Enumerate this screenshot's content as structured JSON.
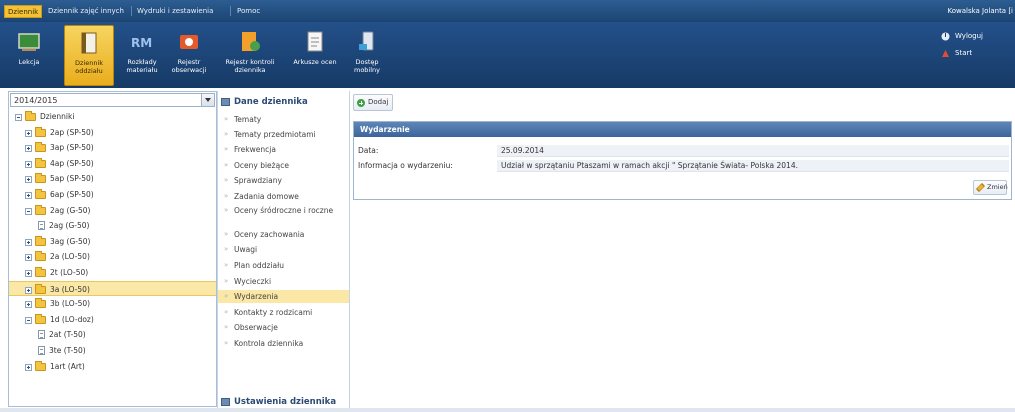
{
  "top_menu": {
    "items": [
      "Dziennik",
      "Dziennik zajęć innych",
      "Wydruki i zestawienia",
      "Pomoc"
    ],
    "active_index": 0,
    "user": "Kowalska Jolanta [i"
  },
  "toolbar": {
    "buttons": [
      {
        "label": "Lekcja",
        "icon": "board-icon"
      },
      {
        "label": "Dziennik oddziału",
        "icon": "journal-icon"
      },
      {
        "label": "Rozkłady materiału",
        "icon": "schedule-icon"
      },
      {
        "label": "Rejestr obserwacji",
        "icon": "observation-icon"
      },
      {
        "label": "Rejestr kontroli dziennika",
        "icon": "inspection-icon"
      },
      {
        "label": "Arkusze ocen",
        "icon": "grade-sheet-icon"
      },
      {
        "label": "Dostęp mobilny",
        "icon": "mobile-icon"
      }
    ],
    "active_index": 1,
    "right_links": [
      {
        "label": "Wyloguj",
        "icon": "logout-icon"
      },
      {
        "label": "Start",
        "icon": "start-icon"
      }
    ]
  },
  "left_pane": {
    "year": "2014/2015",
    "tree": [
      {
        "label": "Dzienniki",
        "level": 0,
        "type": "root",
        "toggle": "minus"
      },
      {
        "label": "2ap (SP-50)",
        "level": 1,
        "type": "folder",
        "toggle": "plus"
      },
      {
        "label": "3ap (SP-50)",
        "level": 1,
        "type": "folder",
        "toggle": "plus"
      },
      {
        "label": "4ap (SP-50)",
        "level": 1,
        "type": "folder",
        "toggle": "plus"
      },
      {
        "label": "5ap (SP-50)",
        "level": 1,
        "type": "folder",
        "toggle": "plus"
      },
      {
        "label": "6ap (SP-50)",
        "level": 1,
        "type": "folder",
        "toggle": "plus"
      },
      {
        "label": "2ag (G-50)",
        "level": 1,
        "type": "folder",
        "toggle": "minus"
      },
      {
        "label": "2ag (G-50)",
        "level": 2,
        "type": "doc",
        "toggle": "none"
      },
      {
        "label": "3ag (G-50)",
        "level": 1,
        "type": "folder",
        "toggle": "plus"
      },
      {
        "label": "2a (LO-50)",
        "level": 1,
        "type": "folder",
        "toggle": "plus"
      },
      {
        "label": "2t (LO-50)",
        "level": 1,
        "type": "folder",
        "toggle": "plus"
      },
      {
        "label": "3a (LO-50)",
        "level": 1,
        "type": "folder",
        "toggle": "plus",
        "selected": true
      },
      {
        "label": "3b (LO-50)",
        "level": 1,
        "type": "folder",
        "toggle": "plus"
      },
      {
        "label": "1d (LO-doz)",
        "level": 1,
        "type": "folder",
        "toggle": "minus"
      },
      {
        "label": "2at (T-50)",
        "level": 2,
        "type": "doc",
        "toggle": "none"
      },
      {
        "label": "3te (T-50)",
        "level": 2,
        "type": "doc",
        "toggle": "none"
      },
      {
        "label": "1art (Art)",
        "level": 1,
        "type": "folder",
        "toggle": "plus"
      }
    ]
  },
  "mid_pane": {
    "header": "Dane dziennika",
    "items": [
      "Tematy",
      "Tematy przedmiotami",
      "Frekwencja",
      "Oceny bieżące",
      "Sprawdziany",
      "Zadania domowe",
      "Oceny śródroczne i roczne",
      "Oceny zachowania",
      "Uwagi",
      "Plan oddziału",
      "Wycieczki",
      "Wydarzenia",
      "Kontakty z rodzicami",
      "Obserwacje",
      "Kontrola dziennika"
    ],
    "selected_index": 11,
    "footer_header": "Ustawienia dziennika"
  },
  "right_pane": {
    "add_button": "Dodaj",
    "panel_title": "Wydarzenie",
    "fields": [
      {
        "label": "Data:",
        "value": "25.09.2014"
      },
      {
        "label": "Informacja o wydarzeniu:",
        "value": "Udział w sprzątaniu Ptaszami w ramach akcji \" Sprzątanie Świata- Polska 2014."
      }
    ],
    "edit_button": "Zmień"
  },
  "colors": {
    "toolbar": "#1c4472",
    "active": "#f3c237",
    "selection": "#fbe8a6",
    "panel_header": "#3c659b"
  }
}
